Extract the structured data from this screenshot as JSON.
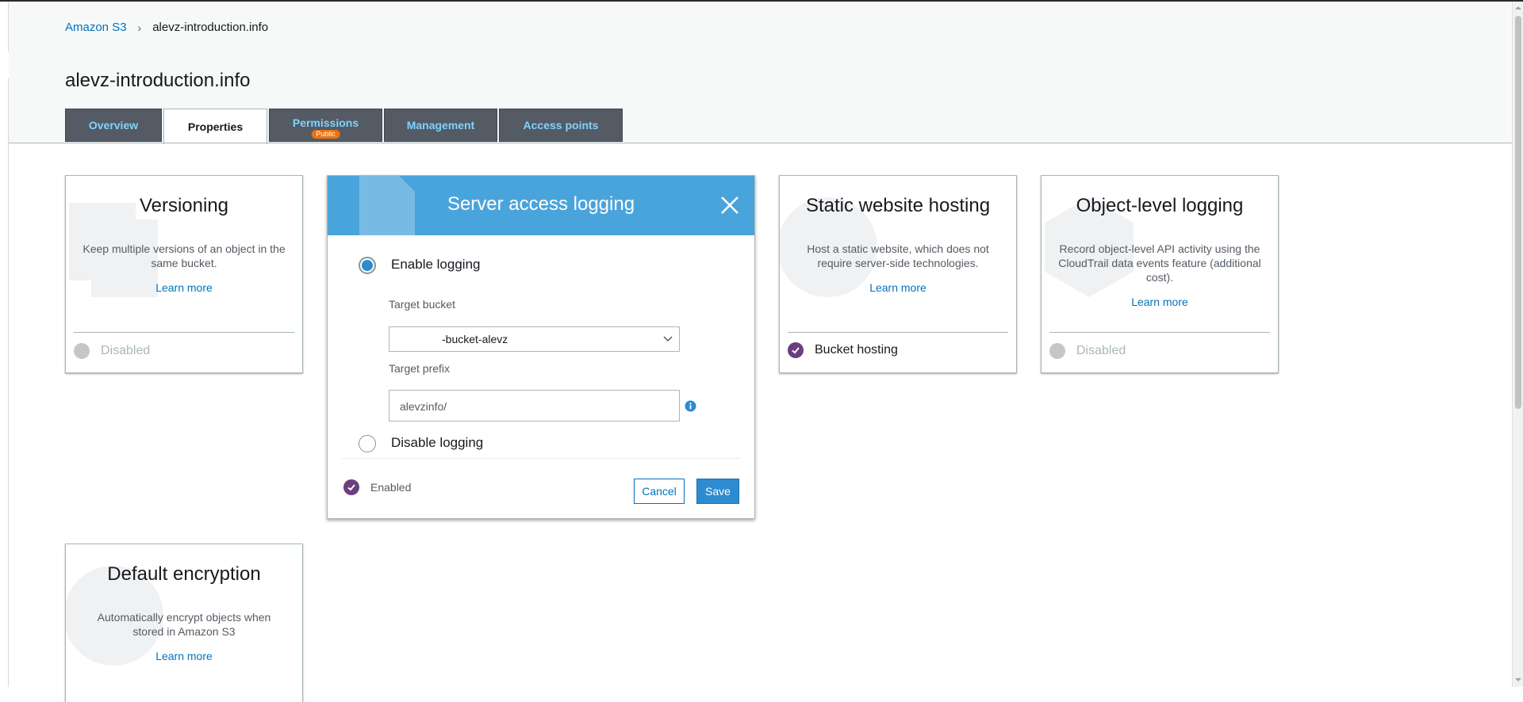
{
  "breadcrumb": {
    "root": "Amazon S3",
    "separator": "›",
    "current": "alevz-introduction.info"
  },
  "page": {
    "title": "alevz-introduction.info"
  },
  "tabs": [
    {
      "label": "Overview",
      "active": false
    },
    {
      "label": "Properties",
      "active": true
    },
    {
      "label": "Permissions",
      "badge": "Public",
      "active": false
    },
    {
      "label": "Management",
      "active": false
    },
    {
      "label": "Access points",
      "active": false
    }
  ],
  "cards": {
    "versioning": {
      "title": "Versioning",
      "description": "Keep multiple versions of an object in the same bucket.",
      "link": "Learn more",
      "status": "Disabled"
    },
    "static_hosting": {
      "title": "Static website hosting",
      "description": "Host a static website, which does not require server-side technologies.",
      "link": "Learn more",
      "status": "Bucket hosting"
    },
    "object_logging": {
      "title": "Object-level logging",
      "description": "Record object-level API activity using the CloudTrail data events feature (additional cost).",
      "link": "Learn more",
      "status": "Disabled"
    },
    "encryption": {
      "title": "Default encryption",
      "description": "Automatically encrypt objects when stored in Amazon S3",
      "link": "Learn more"
    }
  },
  "modal": {
    "title": "Server access logging",
    "enable_label": "Enable logging",
    "target_bucket_label": "Target bucket",
    "target_bucket_value": "-bucket-alevz",
    "target_prefix_label": "Target prefix",
    "target_prefix_value": "alevzinfo/",
    "disable_label": "Disable logging",
    "status": "Enabled",
    "cancel_label": "Cancel",
    "save_label": "Save"
  },
  "colors": {
    "accent_blue": "#4aa4dc",
    "link_blue": "#0073bb",
    "tab_bg": "#545b64",
    "tab_text": "#7fd3ff",
    "enabled_purple": "#6b3f7f",
    "badge_orange": "#ec7211"
  }
}
